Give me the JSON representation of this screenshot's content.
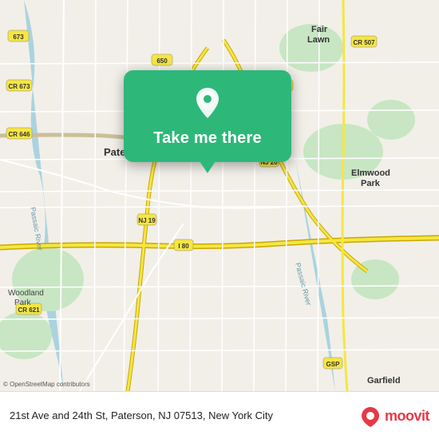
{
  "map": {
    "popup": {
      "button_label": "Take me there"
    },
    "attribution": "© OpenStreetMap contributors"
  },
  "bottom_bar": {
    "address": "21st Ave and 24th St, Paterson, NJ 07513, New York City",
    "brand": "moovit"
  }
}
